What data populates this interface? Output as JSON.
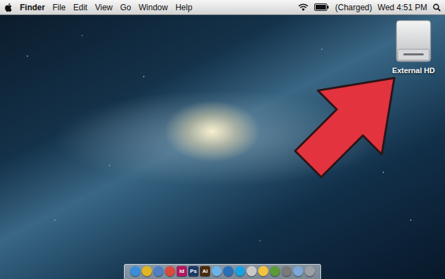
{
  "menu_bar": {
    "app": "Finder",
    "menus": [
      "File",
      "Edit",
      "View",
      "Go",
      "Window",
      "Help"
    ],
    "battery": "(Charged)",
    "clock": "Wed 4:51 PM"
  },
  "desktop_icons": [
    {
      "label": "External HD",
      "selected": false
    }
  ],
  "dock": {
    "items": [
      {
        "kind": "plain",
        "label": "",
        "color": "#3b8fd9"
      },
      {
        "kind": "plain",
        "label": "",
        "color": "#e2b623"
      },
      {
        "kind": "plain",
        "label": "",
        "color": "#4f7fc4"
      },
      {
        "kind": "plain",
        "label": "",
        "color": "#d94b3b"
      },
      {
        "kind": "text",
        "label": "Id",
        "color": "#b0185f"
      },
      {
        "kind": "text",
        "label": "Ps",
        "color": "#1d3a66"
      },
      {
        "kind": "text",
        "label": "Ai",
        "color": "#4a2c0c"
      },
      {
        "kind": "plain",
        "label": "",
        "color": "#6db3e6"
      },
      {
        "kind": "plain",
        "label": "",
        "color": "#2a6fb8"
      },
      {
        "kind": "plain",
        "label": "",
        "color": "#1aa1e0"
      },
      {
        "kind": "plain",
        "label": "",
        "color": "#c9c9c9"
      },
      {
        "kind": "plain",
        "label": "",
        "color": "#f3c340"
      },
      {
        "kind": "plain",
        "label": "",
        "color": "#5c9a3a"
      },
      {
        "kind": "plain",
        "label": "",
        "color": "#7a7a7a"
      },
      {
        "kind": "plain",
        "label": "",
        "color": "#7da7d8"
      },
      {
        "kind": "plain",
        "label": "",
        "color": "#9aa0a6"
      }
    ]
  }
}
